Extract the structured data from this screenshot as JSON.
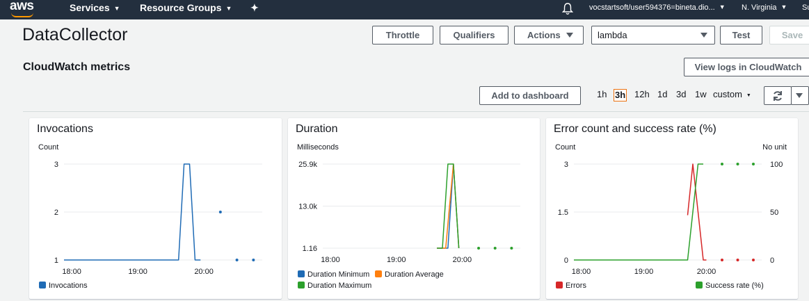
{
  "nav": {
    "logo": "aws",
    "services": "Services",
    "resource_groups": "Resource Groups",
    "account": "vocstartsoft/user594376=bineta.dio...",
    "region": "N. Virginia",
    "support": "Su"
  },
  "header": {
    "title": "DataCollector",
    "throttle": "Throttle",
    "qualifiers": "Qualifiers",
    "actions": "Actions",
    "test_event": "lambda",
    "test": "Test",
    "save": "Save"
  },
  "metrics": {
    "title": "CloudWatch metrics",
    "view_logs": "View logs in CloudWatch",
    "add_dashboard": "Add to dashboard",
    "time_ranges": [
      "1h",
      "3h",
      "12h",
      "1d",
      "3d",
      "1w"
    ],
    "active_range": "3h",
    "custom": "custom"
  },
  "colors": {
    "blue": "#1f6bb5",
    "orange": "#ff7f0e",
    "green": "#2ca02c",
    "red": "#d62728",
    "nav_bg": "#232f3e",
    "accent": "#ec7211"
  },
  "chart_data": [
    {
      "type": "line",
      "title": "Invocations",
      "ylabel": "Count",
      "x_ticks": [
        "18:00",
        "19:00",
        "20:00"
      ],
      "y_ticks": [
        "3",
        "2",
        "1"
      ],
      "ylim": [
        1,
        3
      ],
      "series": [
        {
          "name": "Invocations",
          "color": "#1f6bb5",
          "line": [
            [
              "17:53",
              1
            ],
            [
              "19:37",
              1
            ],
            [
              "19:42",
              3
            ],
            [
              "19:47",
              3
            ],
            [
              "19:52",
              1
            ],
            [
              "19:57",
              1
            ]
          ],
          "points": [
            [
              "20:15",
              2
            ],
            [
              "20:30",
              1
            ],
            [
              "20:45",
              1
            ]
          ]
        }
      ]
    },
    {
      "type": "line",
      "title": "Duration",
      "ylabel": "Milliseconds",
      "x_ticks": [
        "18:00",
        "19:00",
        "20:00"
      ],
      "y_ticks": [
        "25.9k",
        "13.0k",
        "1.16"
      ],
      "ylim": [
        1.16,
        25900
      ],
      "series": [
        {
          "name": "Duration Minimum",
          "color": "#1f6bb5",
          "line": [
            [
              "19:37",
              1.16
            ],
            [
              "19:47",
              1.16
            ],
            [
              "19:52",
              25900
            ],
            [
              "19:57",
              1.16
            ]
          ],
          "points": []
        },
        {
          "name": "Duration Average",
          "color": "#ff7f0e",
          "line": [
            [
              "19:37",
              1.16
            ],
            [
              "19:45",
              1.16
            ],
            [
              "19:52",
              25900
            ],
            [
              "19:57",
              1.16
            ]
          ],
          "points": []
        },
        {
          "name": "Duration Maximum",
          "color": "#2ca02c",
          "line": [
            [
              "19:37",
              1.16
            ],
            [
              "19:42",
              1.16
            ],
            [
              "19:47",
              25900
            ],
            [
              "19:52",
              25900
            ],
            [
              "19:57",
              1.16
            ]
          ],
          "points": [
            [
              "20:15",
              1.16
            ],
            [
              "20:30",
              1.16
            ],
            [
              "20:45",
              1.16
            ]
          ]
        }
      ]
    },
    {
      "type": "line",
      "title": "Error count and success rate (%)",
      "ylabel": "Count",
      "y2label": "No unit",
      "x_ticks": [
        "18:00",
        "19:00",
        "20:00"
      ],
      "y_ticks": [
        "3",
        "1.5",
        "0"
      ],
      "y2_ticks": [
        "100",
        "50",
        "0"
      ],
      "ylim": [
        0,
        3
      ],
      "y2lim": [
        0,
        100
      ],
      "series": [
        {
          "name": "Errors",
          "color": "#d62728",
          "axis": "left",
          "line": [
            [
              "19:42",
              1.4
            ],
            [
              "19:47",
              3
            ],
            [
              "19:57",
              0
            ],
            [
              "20:00",
              0
            ]
          ],
          "points": [
            [
              "20:15",
              0
            ],
            [
              "20:30",
              0
            ],
            [
              "20:45",
              0
            ]
          ]
        },
        {
          "name": "Success rate (%)",
          "color": "#2ca02c",
          "axis": "right",
          "line": [
            [
              "17:53",
              0
            ],
            [
              "19:37",
              0
            ],
            [
              "19:42",
              0
            ],
            [
              "19:52",
              100
            ],
            [
              "19:57",
              100
            ]
          ],
          "points": [
            [
              "20:15",
              100
            ],
            [
              "20:30",
              100
            ],
            [
              "20:45",
              100
            ]
          ]
        }
      ]
    }
  ]
}
